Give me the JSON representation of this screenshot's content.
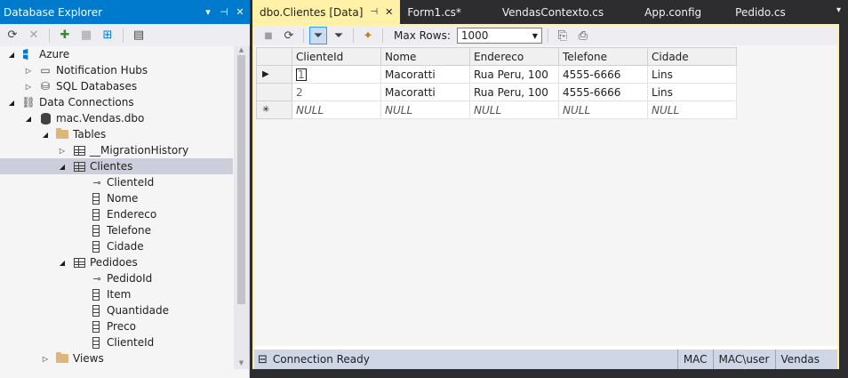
{
  "explorer": {
    "title": "Database Explorer",
    "title_buttons": [
      "▾",
      "⊣",
      "✕"
    ],
    "toolbar_icons": [
      "refresh-icon",
      "cancel-icon",
      "connect-to-database-icon",
      "connect-to-server-icon",
      "connect-to-azure-icon",
      "properties-icon"
    ],
    "tree": [
      {
        "label": "Azure",
        "depth": 0,
        "expanded": true,
        "icon": "azure-icon"
      },
      {
        "label": "Notification Hubs",
        "depth": 1,
        "expanded": false,
        "icon": "notification-hubs-icon"
      },
      {
        "label": "SQL Databases",
        "depth": 1,
        "expanded": false,
        "icon": "sql-databases-icon"
      },
      {
        "label": "Data Connections",
        "depth": 0,
        "expanded": true,
        "icon": "data-connections-icon"
      },
      {
        "label": "mac.Vendas.dbo",
        "depth": 1,
        "expanded": true,
        "icon": "database-icon"
      },
      {
        "label": "Tables",
        "depth": 2,
        "expanded": true,
        "icon": "folder-icon"
      },
      {
        "label": "__MigrationHistory",
        "depth": 3,
        "expanded": false,
        "icon": "table-icon"
      },
      {
        "label": "Clientes",
        "depth": 3,
        "expanded": true,
        "icon": "table-icon",
        "selected": true
      },
      {
        "label": "ClienteId",
        "depth": 4,
        "icon": "key-icon"
      },
      {
        "label": "Nome",
        "depth": 4,
        "icon": "column-icon"
      },
      {
        "label": "Endereco",
        "depth": 4,
        "icon": "column-icon"
      },
      {
        "label": "Telefone",
        "depth": 4,
        "icon": "column-icon"
      },
      {
        "label": "Cidade",
        "depth": 4,
        "icon": "column-icon"
      },
      {
        "label": "Pedidoes",
        "depth": 3,
        "expanded": true,
        "icon": "table-icon"
      },
      {
        "label": "PedidoId",
        "depth": 4,
        "icon": "key-icon"
      },
      {
        "label": "Item",
        "depth": 4,
        "icon": "column-icon"
      },
      {
        "label": "Quantidade",
        "depth": 4,
        "icon": "column-icon"
      },
      {
        "label": "Preco",
        "depth": 4,
        "icon": "column-icon"
      },
      {
        "label": "ClienteId",
        "depth": 4,
        "icon": "column-icon"
      },
      {
        "label": "Views",
        "depth": 2,
        "expanded": false,
        "icon": "folder-icon"
      }
    ]
  },
  "tabs": [
    {
      "label": "dbo.Clientes [Data]",
      "active": true,
      "pin": "⊣",
      "close": "✕"
    },
    {
      "label": "Form1.cs*"
    },
    {
      "label": "VendasContexto.cs"
    },
    {
      "label": "App.config"
    },
    {
      "label": "Pedido.cs"
    }
  ],
  "tab_overflow": "▾",
  "data_toolbar": {
    "max_rows_label": "Max Rows:",
    "max_rows_value": "1000"
  },
  "grid": {
    "columns": [
      "ClienteId",
      "Nome",
      "Endereco",
      "Telefone",
      "Cidade"
    ],
    "rows": [
      {
        "marker": "▶",
        "cells": [
          "1",
          "Macoratti",
          "Rua Peru, 100",
          "4555-6666",
          "Lins"
        ]
      },
      {
        "marker": "",
        "cells": [
          "2",
          "Macoratti",
          "Rua Peru, 100",
          "4555-6666",
          "Lins"
        ]
      },
      {
        "marker": "✳",
        "cells": [
          "NULL",
          "NULL",
          "NULL",
          "NULL",
          "NULL"
        ],
        "new_row": true
      }
    ]
  },
  "status": {
    "connection": "Connection Ready",
    "server": "MAC",
    "user": "MAC\\user",
    "database": "Vendas"
  },
  "colors": {
    "accent": "#007acc",
    "active_tab": "#fff1a8",
    "chrome": "#2d2d30",
    "selection": "#cccedb"
  }
}
